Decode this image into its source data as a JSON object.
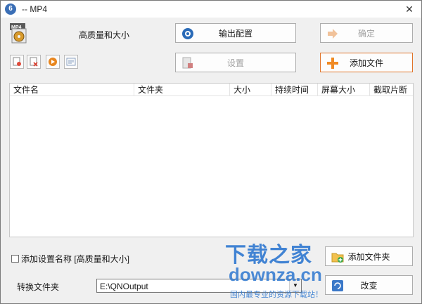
{
  "window": {
    "title": "-- MP4",
    "app_icon_text": "6",
    "close_glyph": "✕"
  },
  "preset": {
    "icon": "mp4-video-file-icon",
    "icon_badge": "MP4",
    "name": "高质量和大小"
  },
  "buttons": {
    "output_config": "输出配置",
    "confirm": "确定",
    "settings": "设置",
    "add_file": "添加文件",
    "add_folder": "添加文件夹",
    "change": "改变"
  },
  "toolbar": {
    "items": [
      {
        "icon": "clear-list-icon"
      },
      {
        "icon": "remove-file-icon"
      },
      {
        "icon": "play-icon"
      },
      {
        "icon": "file-info-icon"
      }
    ]
  },
  "table": {
    "columns": [
      "文件名",
      "文件夹",
      "大小",
      "持续时间",
      "屏幕大小",
      "截取片断"
    ],
    "rows": []
  },
  "options": {
    "add_preset_name_label": "添加设置名称 [高质量和大小]",
    "add_preset_name_checked": false
  },
  "output": {
    "label": "转换文件夹",
    "path": "E:\\QNOutput"
  },
  "watermark": {
    "line1": "下载之家",
    "line2": "downza.cn",
    "line3": "国内最专业的资源下载站！"
  },
  "colors": {
    "accent_orange": "#e0742a",
    "watermark_blue": "#2f78d0"
  }
}
